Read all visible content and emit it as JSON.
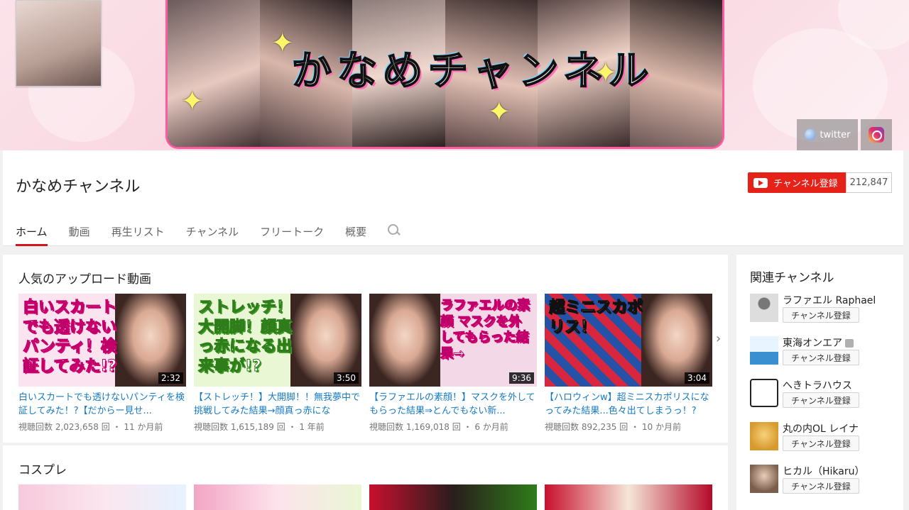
{
  "banner": {
    "title": "かなめチャンネル",
    "links": [
      {
        "label": "twitter",
        "icon": "globe-icon"
      },
      {
        "label": "",
        "icon": "instagram-icon"
      }
    ]
  },
  "header": {
    "channel_name": "かなめチャンネル",
    "subscribe_label": "チャンネル登録",
    "subscriber_count": "212,847",
    "tabs": [
      {
        "label": "ホーム",
        "active": true
      },
      {
        "label": "動画"
      },
      {
        "label": "再生リスト"
      },
      {
        "label": "チャンネル"
      },
      {
        "label": "フリートーク"
      },
      {
        "label": "概要"
      }
    ]
  },
  "popular": {
    "title": "人気のアップロード動画",
    "videos": [
      {
        "thumb_text": "白いスカートでも透けないパンティ！検証してみた!?",
        "thumb_bg": "#fbe4ef",
        "duration": "2:32",
        "title": "白いスカートでも透けないパンティを検証してみた！?【だからー見せ...",
        "meta": "視聴回数 2,023,658 回 ・ 11 か月前"
      },
      {
        "thumb_text": "ストレッチ！大開脚！顔真っ赤になる出来事が!?",
        "thumb_bg": "#e9f7d4",
        "duration": "3:50",
        "title": "【ストレッチ！】大開脚！！無我夢中で挑戦してみた結果→顔真っ赤にな",
        "meta": "視聴回数 1,615,189 回 ・ 1 年前"
      },
      {
        "thumb_text": "ラファエルの素顔 マスクを外してもらった結果→",
        "thumb_bg": "#f3d9e8",
        "duration": "9:36",
        "title": "【ラファエルの素顔！】マスクを外してもらった結果⇒とんでもない新...",
        "meta": "視聴回数 1,169,018 回 ・ 6 か月前"
      },
      {
        "thumb_text": "超ミニスカポリス！",
        "thumb_bg": "#e8f0ff",
        "duration": "3:04",
        "title": "【ハロウィンw】超ミニスカポリスになってみた結果...色々出てしまうっ！?",
        "meta": "視聴回数 892,235 回 ・ 10 か月前"
      }
    ]
  },
  "cosplay": {
    "title": "コスプレ"
  },
  "sidebar": {
    "title": "関連チャンネル",
    "subscribe_label": "チャンネル登録",
    "channels": [
      {
        "name": "ラファエル Raphael",
        "avatar_color": "#c9c9c9",
        "verified": false
      },
      {
        "name": "東海オンエア",
        "avatar_color": "#3a8fd0",
        "verified": true
      },
      {
        "name": "へきトラハウス",
        "avatar_color": "#ffffff",
        "verified": false
      },
      {
        "name": "丸の内OL レイナ",
        "avatar_color": "#e8b24a",
        "verified": false
      },
      {
        "name": "ヒカル（Hikaru）",
        "avatar_color": "#b9a08a",
        "verified": false
      }
    ]
  },
  "colors": {
    "accent": "#e62117",
    "link": "#167ac6",
    "tab_underline": "#cc181e"
  }
}
